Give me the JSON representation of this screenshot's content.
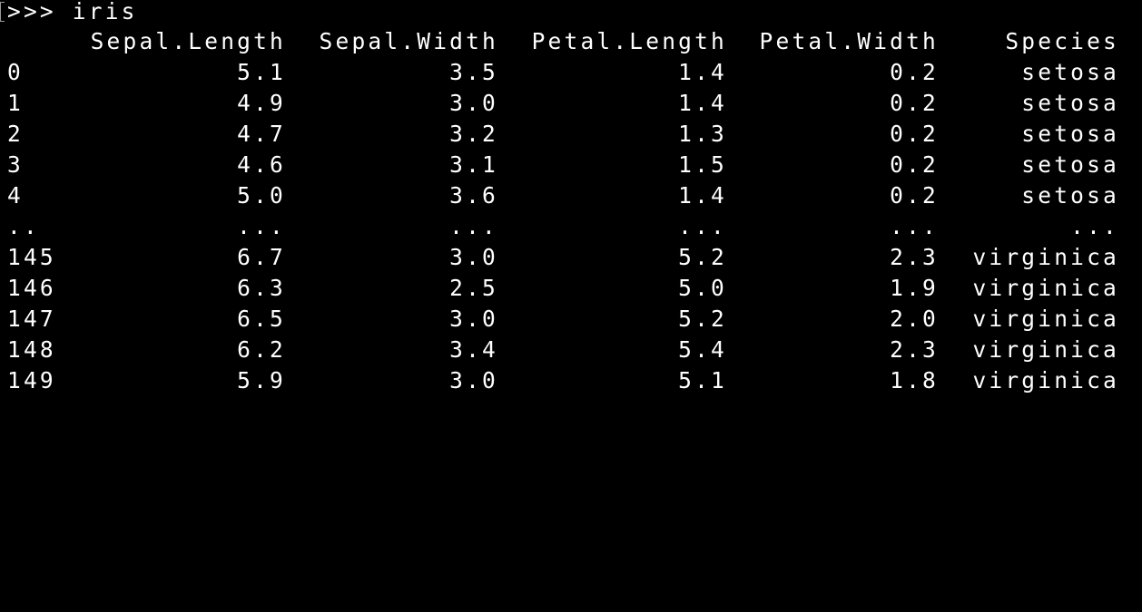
{
  "terminal": {
    "prompt": ">>> iris",
    "columns": {
      "sepal_length": "Sepal.Length",
      "sepal_width": "Sepal.Width",
      "petal_length": "Petal.Length",
      "petal_width": "Petal.Width",
      "species": "Species"
    },
    "rows": [
      {
        "idx": "0",
        "sl": "5.1",
        "sw": "3.5",
        "pl": "1.4",
        "pw": "0.2",
        "sp": "setosa"
      },
      {
        "idx": "1",
        "sl": "4.9",
        "sw": "3.0",
        "pl": "1.4",
        "pw": "0.2",
        "sp": "setosa"
      },
      {
        "idx": "2",
        "sl": "4.7",
        "sw": "3.2",
        "pl": "1.3",
        "pw": "0.2",
        "sp": "setosa"
      },
      {
        "idx": "3",
        "sl": "4.6",
        "sw": "3.1",
        "pl": "1.5",
        "pw": "0.2",
        "sp": "setosa"
      },
      {
        "idx": "4",
        "sl": "5.0",
        "sw": "3.6",
        "pl": "1.4",
        "pw": "0.2",
        "sp": "setosa"
      },
      {
        "idx": "..",
        "sl": "...",
        "sw": "...",
        "pl": "...",
        "pw": "...",
        "sp": "..."
      },
      {
        "idx": "145",
        "sl": "6.7",
        "sw": "3.0",
        "pl": "5.2",
        "pw": "2.3",
        "sp": "virginica"
      },
      {
        "idx": "146",
        "sl": "6.3",
        "sw": "2.5",
        "pl": "5.0",
        "pw": "1.9",
        "sp": "virginica"
      },
      {
        "idx": "147",
        "sl": "6.5",
        "sw": "3.0",
        "pl": "5.2",
        "pw": "2.0",
        "sp": "virginica"
      },
      {
        "idx": "148",
        "sl": "6.2",
        "sw": "3.4",
        "pl": "5.4",
        "pw": "2.3",
        "sp": "virginica"
      },
      {
        "idx": "149",
        "sl": "5.9",
        "sw": "3.0",
        "pl": "5.1",
        "pw": "1.8",
        "sp": "virginica"
      }
    ]
  },
  "colors": {
    "background": "#000000",
    "text": "#ffffff"
  }
}
